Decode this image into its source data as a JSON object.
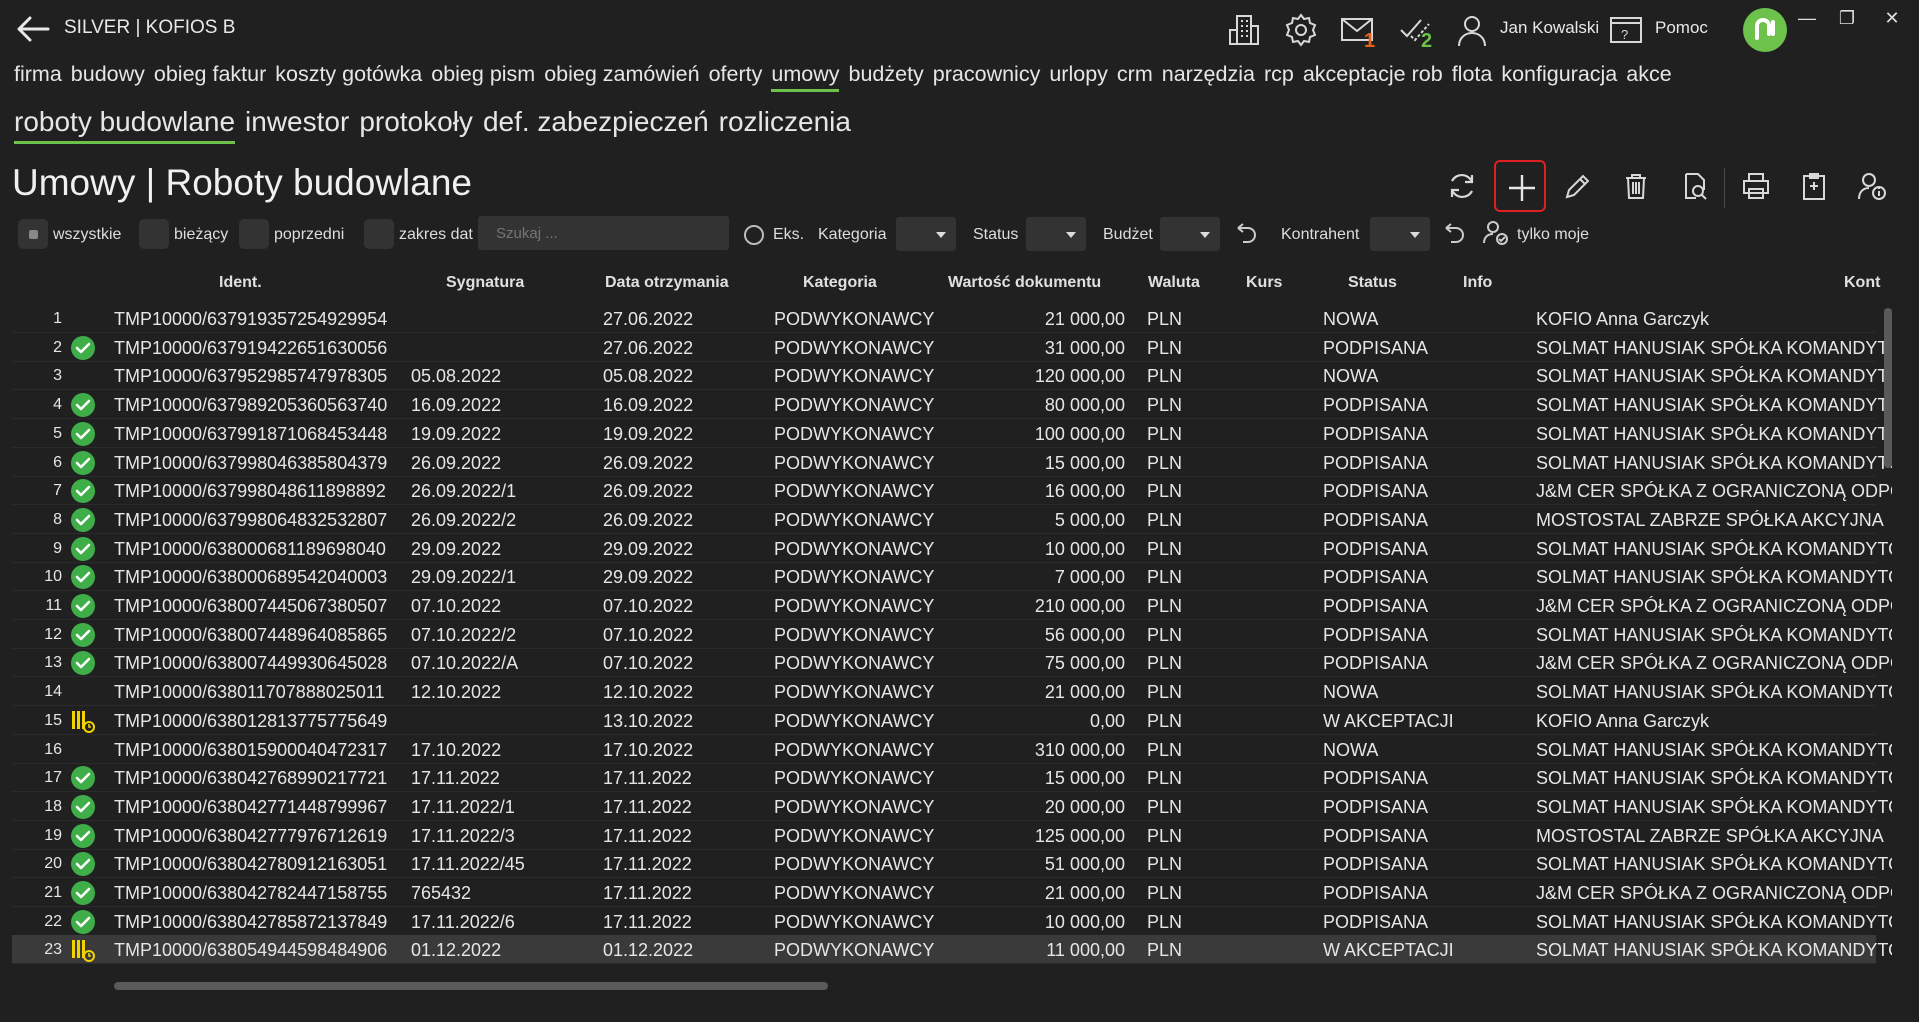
{
  "app": {
    "title": "SILVER | KOFIOS B",
    "user": "Jan Kowalski",
    "help": "Pomoc",
    "mail_badge": "1",
    "tasks_badge": "2",
    "accent": "#6cc24a",
    "badge_color": "#e8621a"
  },
  "nav": {
    "main": [
      "firma",
      "budowy",
      "obieg faktur",
      "koszty gotówka",
      "obieg pism",
      "obieg zamówień",
      "oferty",
      "umowy",
      "budżety",
      "pracownicy",
      "urlopy",
      "crm",
      "narzędzia",
      "rcp",
      "akceptacje rob",
      "flota",
      "konfiguracja",
      "akce"
    ],
    "main_active": "umowy",
    "sub": [
      "roboty budowlane",
      "inwestor",
      "protokoły",
      "def. zabezpieczeń",
      "rozliczenia"
    ],
    "sub_active": "roboty budowlane"
  },
  "page": {
    "title": "Umowy | Roboty budowlane"
  },
  "filters": {
    "all": "wszystkie",
    "current": "bieżący",
    "previous": "poprzedni",
    "date_range": "zakres dat",
    "search_placeholder": "Szukaj ...",
    "eks": "Eks.",
    "category": "Kategoria",
    "status": "Status",
    "budget": "Budżet",
    "contractor": "Kontrahent",
    "only_mine": "tylko moje"
  },
  "toolbar_icons": [
    "refresh-icon",
    "add-icon",
    "edit-icon",
    "delete-icon",
    "preview-icon",
    "print-icon",
    "clipboard-icon",
    "user-info-icon"
  ],
  "table": {
    "columns": {
      "ident": "Ident.",
      "sygnatura": "Sygnatura",
      "data": "Data otrzymania",
      "kategoria": "Kategoria",
      "wartosc": "Wartość dokumentu",
      "waluta": "Waluta",
      "kurs": "Kurs",
      "status": "Status",
      "info": "Info",
      "kontrahent": "Kont"
    },
    "rows": [
      {
        "n": "1",
        "icon": "",
        "ident": "TMP10000/637919357254929954",
        "syg": "",
        "data": "27.06.2022",
        "kat": "PODWYKONAWCY",
        "val": "21 000,00",
        "wal": "PLN",
        "status": "NOWA",
        "kon": "KOFIO Anna Garczyk"
      },
      {
        "n": "2",
        "icon": "check",
        "ident": "TMP10000/637919422651630056",
        "syg": "",
        "data": "27.06.2022",
        "kat": "PODWYKONAWCY",
        "val": "31 000,00",
        "wal": "PLN",
        "status": "PODPISANA",
        "kon": "SOLMAT HANUSIAK SPÓŁKA KOMANDYTOWA"
      },
      {
        "n": "3",
        "icon": "",
        "ident": "TMP10000/637952985747978305",
        "syg": "05.08.2022",
        "data": "05.08.2022",
        "kat": "PODWYKONAWCY",
        "val": "120 000,00",
        "wal": "PLN",
        "status": "NOWA",
        "kon": "SOLMAT HANUSIAK SPÓŁKA KOMANDYTOWA"
      },
      {
        "n": "4",
        "icon": "check",
        "ident": "TMP10000/637989205360563740",
        "syg": "16.09.2022",
        "data": "16.09.2022",
        "kat": "PODWYKONAWCY",
        "val": "80 000,00",
        "wal": "PLN",
        "status": "PODPISANA",
        "kon": "SOLMAT HANUSIAK SPÓŁKA KOMANDYTOWA"
      },
      {
        "n": "5",
        "icon": "check",
        "ident": "TMP10000/637991871068453448",
        "syg": "19.09.2022",
        "data": "19.09.2022",
        "kat": "PODWYKONAWCY",
        "val": "100 000,00",
        "wal": "PLN",
        "status": "PODPISANA",
        "kon": "SOLMAT HANUSIAK SPÓŁKA KOMANDYTOWA"
      },
      {
        "n": "6",
        "icon": "check",
        "ident": "TMP10000/637998046385804379",
        "syg": "26.09.2022",
        "data": "26.09.2022",
        "kat": "PODWYKONAWCY",
        "val": "15 000,00",
        "wal": "PLN",
        "status": "PODPISANA",
        "kon": "SOLMAT HANUSIAK SPÓŁKA KOMANDYTOWA"
      },
      {
        "n": "7",
        "icon": "check",
        "ident": "TMP10000/637998048611898892",
        "syg": "26.09.2022/1",
        "data": "26.09.2022",
        "kat": "PODWYKONAWCY",
        "val": "16 000,00",
        "wal": "PLN",
        "status": "PODPISANA",
        "kon": "J&M CER SPÓŁKA Z OGRANICZONĄ ODPOWIEDZIALNOŚCIĄ"
      },
      {
        "n": "8",
        "icon": "check",
        "ident": "TMP10000/637998064832532807",
        "syg": "26.09.2022/2",
        "data": "26.09.2022",
        "kat": "PODWYKONAWCY",
        "val": "5 000,00",
        "wal": "PLN",
        "status": "PODPISANA",
        "kon": "MOSTOSTAL ZABRZE SPÓŁKA AKCYJNA"
      },
      {
        "n": "9",
        "icon": "check",
        "ident": "TMP10000/638000681189698040",
        "syg": "29.09.2022",
        "data": "29.09.2022",
        "kat": "PODWYKONAWCY",
        "val": "10 000,00",
        "wal": "PLN",
        "status": "PODPISANA",
        "kon": "SOLMAT HANUSIAK SPÓŁKA KOMANDYTOWA"
      },
      {
        "n": "10",
        "icon": "check",
        "ident": "TMP10000/638000689542040003",
        "syg": "29.09.2022/1",
        "data": "29.09.2022",
        "kat": "PODWYKONAWCY",
        "val": "7 000,00",
        "wal": "PLN",
        "status": "PODPISANA",
        "kon": "SOLMAT HANUSIAK SPÓŁKA KOMANDYTOWA"
      },
      {
        "n": "11",
        "icon": "check",
        "ident": "TMP10000/638007445067380507",
        "syg": "07.10.2022",
        "data": "07.10.2022",
        "kat": "PODWYKONAWCY",
        "val": "210 000,00",
        "wal": "PLN",
        "status": "PODPISANA",
        "kon": "J&M CER SPÓŁKA Z OGRANICZONĄ ODPOWIEDZIALNOŚCIĄ"
      },
      {
        "n": "12",
        "icon": "check",
        "ident": "TMP10000/638007448964085865",
        "syg": "07.10.2022/2",
        "data": "07.10.2022",
        "kat": "PODWYKONAWCY",
        "val": "56 000,00",
        "wal": "PLN",
        "status": "PODPISANA",
        "kon": "SOLMAT HANUSIAK SPÓŁKA KOMANDYTOWA"
      },
      {
        "n": "13",
        "icon": "check",
        "ident": "TMP10000/638007449930645028",
        "syg": "07.10.2022/A",
        "data": "07.10.2022",
        "kat": "PODWYKONAWCY",
        "val": "75 000,00",
        "wal": "PLN",
        "status": "PODPISANA",
        "kon": "J&M CER SPÓŁKA Z OGRANICZONĄ ODPOWIEDZIALNOŚCIĄ"
      },
      {
        "n": "14",
        "icon": "",
        "ident": "TMP10000/638011707888025011",
        "syg": "12.10.2022",
        "data": "12.10.2022",
        "kat": "PODWYKONAWCY",
        "val": "21 000,00",
        "wal": "PLN",
        "status": "NOWA",
        "kon": "SOLMAT HANUSIAK SPÓŁKA KOMANDYTOWA"
      },
      {
        "n": "15",
        "icon": "pending",
        "ident": "TMP10000/638012813775775649",
        "syg": "",
        "data": "13.10.2022",
        "kat": "PODWYKONAWCY",
        "val": "0,00",
        "wal": "PLN",
        "status": "W AKCEPTACJI",
        "kon": "KOFIO Anna Garczyk"
      },
      {
        "n": "16",
        "icon": "",
        "ident": "TMP10000/638015900040472317",
        "syg": "17.10.2022",
        "data": "17.10.2022",
        "kat": "PODWYKONAWCY",
        "val": "310 000,00",
        "wal": "PLN",
        "status": "NOWA",
        "kon": "SOLMAT HANUSIAK SPÓŁKA KOMANDYTOWA"
      },
      {
        "n": "17",
        "icon": "check",
        "ident": "TMP10000/638042768990217721",
        "syg": "17.11.2022",
        "data": "17.11.2022",
        "kat": "PODWYKONAWCY",
        "val": "15 000,00",
        "wal": "PLN",
        "status": "PODPISANA",
        "kon": "SOLMAT HANUSIAK SPÓŁKA KOMANDYTOWA"
      },
      {
        "n": "18",
        "icon": "check",
        "ident": "TMP10000/638042771448799967",
        "syg": "17.11.2022/1",
        "data": "17.11.2022",
        "kat": "PODWYKONAWCY",
        "val": "20 000,00",
        "wal": "PLN",
        "status": "PODPISANA",
        "kon": "SOLMAT HANUSIAK SPÓŁKA KOMANDYTOWA"
      },
      {
        "n": "19",
        "icon": "check",
        "ident": "TMP10000/638042777976712619",
        "syg": "17.11.2022/3",
        "data": "17.11.2022",
        "kat": "PODWYKONAWCY",
        "val": "125 000,00",
        "wal": "PLN",
        "status": "PODPISANA",
        "kon": "MOSTOSTAL ZABRZE SPÓŁKA AKCYJNA"
      },
      {
        "n": "20",
        "icon": "check",
        "ident": "TMP10000/638042780912163051",
        "syg": "17.11.2022/45",
        "data": "17.11.2022",
        "kat": "PODWYKONAWCY",
        "val": "51 000,00",
        "wal": "PLN",
        "status": "PODPISANA",
        "kon": "SOLMAT HANUSIAK SPÓŁKA KOMANDYTOWA"
      },
      {
        "n": "21",
        "icon": "check",
        "ident": "TMP10000/638042782447158755",
        "syg": "765432",
        "data": "17.11.2022",
        "kat": "PODWYKONAWCY",
        "val": "21 000,00",
        "wal": "PLN",
        "status": "PODPISANA",
        "kon": "J&M CER SPÓŁKA Z OGRANICZONĄ ODPOWIEDZIALNOŚCIĄ"
      },
      {
        "n": "22",
        "icon": "check",
        "ident": "TMP10000/638042785872137849",
        "syg": "17.11.2022/6",
        "data": "17.11.2022",
        "kat": "PODWYKONAWCY",
        "val": "10 000,00",
        "wal": "PLN",
        "status": "PODPISANA",
        "kon": "SOLMAT HANUSIAK SPÓŁKA KOMANDYTOWA"
      },
      {
        "n": "23",
        "icon": "pending",
        "ident": "TMP10000/638054944598484906",
        "syg": "01.12.2022",
        "data": "01.12.2022",
        "kat": "PODWYKONAWCY",
        "val": "11 000,00",
        "wal": "PLN",
        "status": "W AKCEPTACJI",
        "kon": "SOLMAT HANUSIAK SPÓŁKA KOMANDYTOWA",
        "selected": true
      }
    ]
  }
}
